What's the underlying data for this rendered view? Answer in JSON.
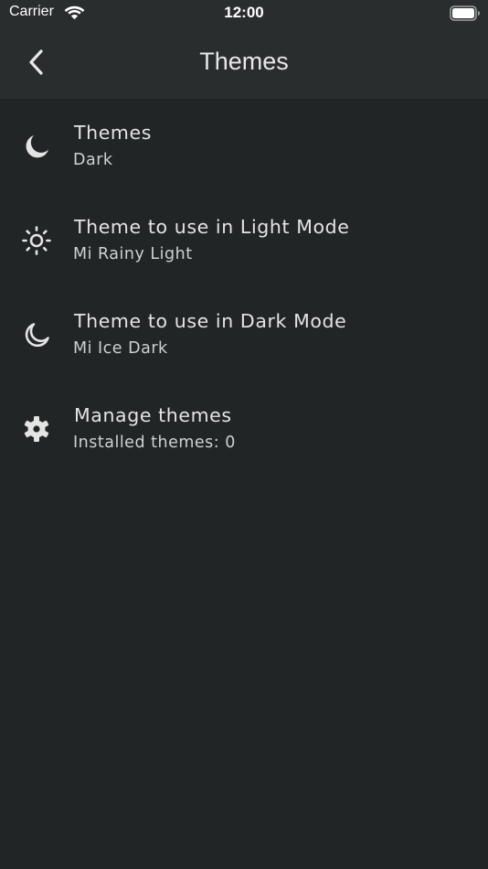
{
  "status_bar": {
    "carrier": "Carrier",
    "time": "12:00",
    "wifi_icon": "wifi-icon",
    "battery_icon": "battery-full-icon"
  },
  "header": {
    "title": "Themes",
    "back_icon": "chevron-left-icon"
  },
  "settings": [
    {
      "icon": "moon-filled-icon",
      "title": "Themes",
      "value": "Dark"
    },
    {
      "icon": "sun-icon",
      "title": "Theme to use in Light Mode",
      "value": "Mi Rainy Light"
    },
    {
      "icon": "moon-outline-icon",
      "title": "Theme to use in Dark Mode",
      "value": "Mi Ice Dark"
    },
    {
      "icon": "gear-icon",
      "title": "Manage themes",
      "value": "Installed themes: 0"
    }
  ],
  "colors": {
    "background": "#212526",
    "header_background": "#292d2e",
    "primary_text": "#e4e4e4",
    "secondary_text": "#cfd1d2"
  }
}
